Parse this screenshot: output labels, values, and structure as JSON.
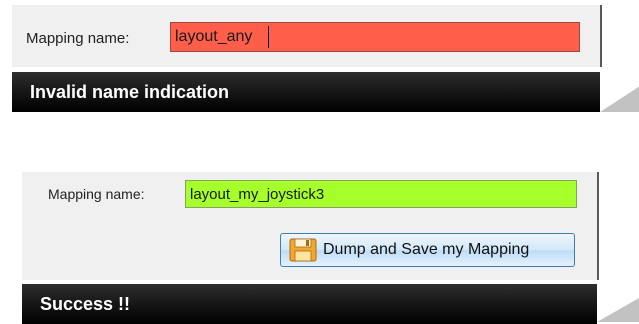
{
  "invalid_example": {
    "label": "Mapping name:",
    "value": "layout_any",
    "field_color": "#ff5e4a",
    "caption": "Invalid name indication"
  },
  "success_example": {
    "label": "Mapping name:",
    "value": "layout_my_joystick3",
    "field_color": "#a6ff2a",
    "button_label": "Dump and Save my Mapping",
    "button_icon": "floppy-disk-icon",
    "caption": "Success !!"
  }
}
